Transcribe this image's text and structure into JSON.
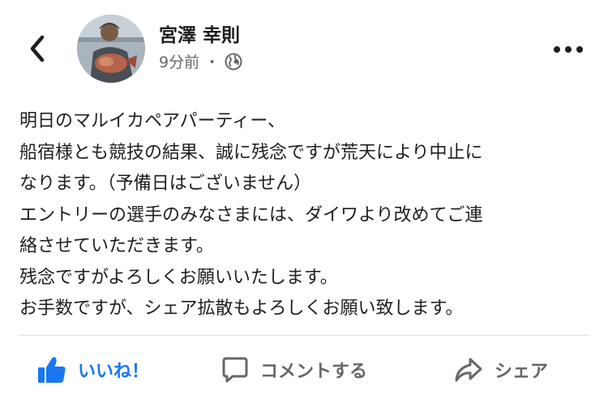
{
  "header": {
    "author_name": "宮澤 幸則",
    "time_ago": "9分前",
    "separator": "・",
    "privacy_icon": "globe-icon",
    "back_icon": "chevron-left-icon",
    "more_icon": "more-horizontal-icon",
    "avatar_alt": "avatar"
  },
  "post": {
    "lines": [
      "明日のマルイカペアパーティー、",
      "船宿様とも競技の結果、誠に残念ですが荒天により中止に",
      "なります。（予備日はございません）",
      "エントリーの選手のみなさまには、ダイワより改めてご連",
      "絡させていただきます。",
      "残念ですがよろしくお願いいたします。",
      "お手数ですが、シェア拡散もよろしくお願い致します。"
    ]
  },
  "actions": {
    "like_label": "いいね！",
    "comment_label": "コメントする",
    "share_label": "シェア"
  },
  "colors": {
    "like_blue": "#1877f2",
    "text_primary": "#1c1e21",
    "text_secondary": "#65676b",
    "divider": "#dadde1"
  }
}
